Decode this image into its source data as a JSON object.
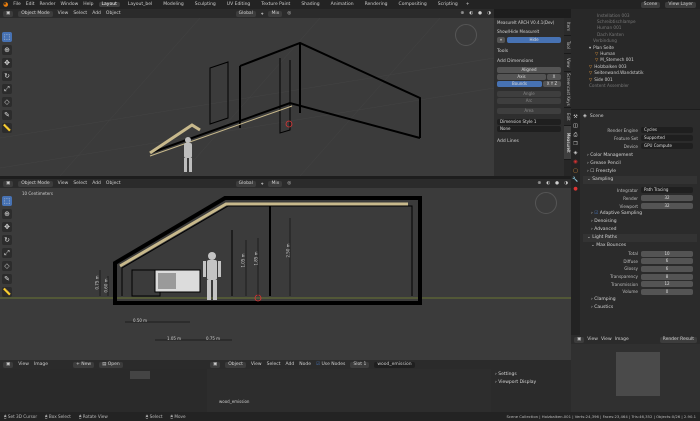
{
  "topbar": {
    "menus": [
      "File",
      "Edit",
      "Render",
      "Window",
      "Help"
    ],
    "tabs": [
      "Layout",
      "Layout_bel",
      "Modeling",
      "Sculpting",
      "UV Editing",
      "Texture Paint",
      "Shading",
      "Animation",
      "Rendering",
      "Compositing",
      "Scripting"
    ],
    "scene": "Scene",
    "view_layer": "View Layer"
  },
  "viewport_top": {
    "mode": "Object Mode",
    "menus": [
      "View",
      "Select",
      "Add",
      "Object"
    ],
    "orientation": "Global",
    "pivot": "Mix"
  },
  "viewport_bottom": {
    "mode": "Object Mode",
    "menus": [
      "View",
      "Select",
      "Add",
      "Object"
    ],
    "orientation": "Global",
    "pivot": "Mix",
    "scale_text": "10 Centimeters",
    "dims": [
      "0.75 m",
      "0.60 m",
      "1.05 m",
      "1.85 m",
      "2.50 m",
      "0.50 m",
      "1.05 m",
      "0.75 m"
    ]
  },
  "measureit": {
    "title": "MeasureIt ARCH V0.4.1(Dev)",
    "show_hide": "Show/Hide Measurelt",
    "hide_btn": "Hide",
    "tools": "Tools",
    "add_dimensions": "Add Dimensions",
    "aligned": "Aligned",
    "axis": "Axis",
    "axis_value": "X",
    "bounds": "Bounds",
    "bounds_value": "X Y Z",
    "angle": "Angle",
    "arc": "Arc",
    "area": "Area",
    "dim_style": "Dimension Style 1",
    "none": "None",
    "add_lines": "Add Lines",
    "side_tabs": [
      "Item",
      "Tool",
      "View",
      "Screencast Keys",
      "Edit",
      "MeasureIt"
    ]
  },
  "outliner": {
    "items": [
      "Instellation 003",
      "Schreibtischlampe",
      "Human 001",
      "Dach Kanten",
      "Verbindung",
      "Plan Seite",
      "Human",
      "M_Stemech 001",
      "Holzbalken 003",
      "Seitenwand.Wandstatik",
      "Side 001",
      "Content Assembler"
    ]
  },
  "properties": {
    "title": "Scene",
    "render_engine_label": "Render Engine",
    "render_engine": "Cycles",
    "feature_set_label": "Feature Set",
    "feature_set": "Supported",
    "device_label": "Device",
    "device": "GPU Compute",
    "color_management": "Color Management",
    "grease_pencil": "Grease Pencil",
    "freestyle": "Freestyle",
    "sampling": "Sampling",
    "integrator_label": "Integrator",
    "integrator": "Path Tracing",
    "render_label": "Render",
    "render_value": "32",
    "viewport_label": "Viewport",
    "viewport_value": "32",
    "adaptive": "Adaptive Sampling",
    "denoising": "Denoising",
    "advanced": "Advanced",
    "light_paths": "Light Paths",
    "max_bounces": "Max Bounces",
    "bounces": [
      {
        "label": "Total",
        "value": "10"
      },
      {
        "label": "Diffuse",
        "value": "6"
      },
      {
        "label": "Glossy",
        "value": "6"
      },
      {
        "label": "Transparency",
        "value": "8"
      },
      {
        "label": "Transmission",
        "value": "12"
      },
      {
        "label": "Volume",
        "value": "0"
      }
    ],
    "clamping": "Clamping",
    "caustics": "Caustics"
  },
  "image_editor": {
    "menus": [
      "View",
      "Image"
    ],
    "new_btn": "New",
    "open_btn": "Open"
  },
  "node_editor": {
    "type": "Object",
    "menus": [
      "View",
      "Select",
      "Add",
      "Node"
    ],
    "use_nodes": "Use Nodes",
    "slot": "Slot 1",
    "material": "wood_emission",
    "node_label": "wood_emission",
    "settings": "Settings",
    "viewport_display": "Viewport Display"
  },
  "render_result": {
    "menus": [
      "View",
      "View",
      "Image"
    ],
    "name": "Render Result"
  },
  "statusbar": {
    "items": [
      "Set 3D Cursor",
      "Box Select",
      "Rotate View",
      "Select",
      "Move"
    ],
    "stats": "Scene Collection | Holzbalken.001 | Verts:24,396 | Faces:23,464 | Tris:46,352 | Objects:0/26 | 2.90.1"
  }
}
